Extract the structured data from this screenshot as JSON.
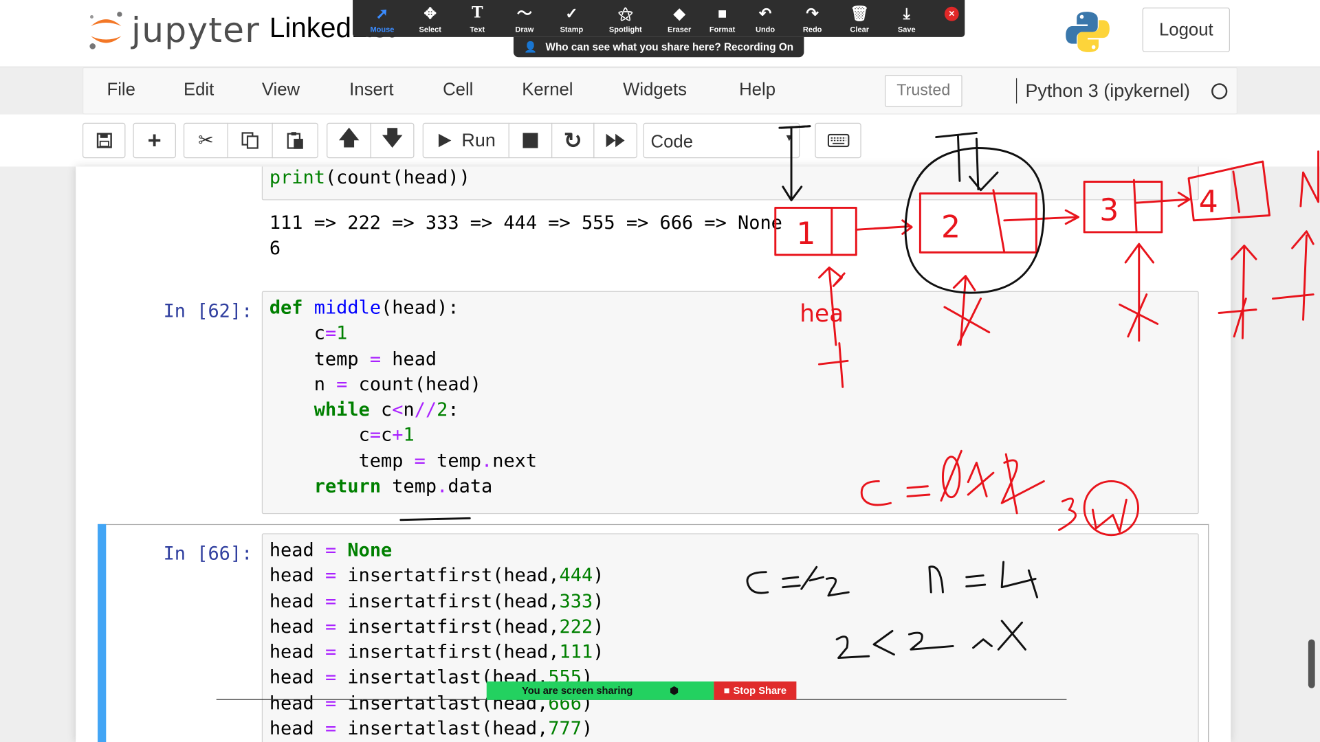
{
  "header": {
    "logo_text": "jupyter",
    "notebook_title": "LinkedList",
    "logout_label": "Logout"
  },
  "menubar": {
    "items": [
      "File",
      "Edit",
      "View",
      "Insert",
      "Cell",
      "Kernel",
      "Widgets",
      "Help"
    ],
    "trusted_label": "Trusted",
    "kernel_label": "Python 3 (ipykernel)"
  },
  "toolbar": {
    "run_label": "Run",
    "cell_type": "Code",
    "icons": [
      "save-icon",
      "plus-icon",
      "scissors-icon",
      "copy-icon",
      "paste-icon",
      "arrow-up-icon",
      "arrow-down-icon",
      "play-icon",
      "stop-icon",
      "restart-icon",
      "fast-forward-icon",
      "keyboard-icon"
    ]
  },
  "zoom_annotation_toolbar": {
    "items": [
      "Mouse",
      "Select",
      "Text",
      "Draw",
      "Stamp",
      "Spotlight",
      "Eraser",
      "Format",
      "Undo",
      "Redo",
      "Clear",
      "Save"
    ],
    "recording_notice": "Who can see what you share here? Recording On"
  },
  "screen_share_bar": {
    "status": "You are screen sharing",
    "stop_label": "Stop Share"
  },
  "cells": {
    "cell1_code_tail": "print(count(head))",
    "cell1_output_line1": "111 => 222 => 333 => 444 => 555 => 666 => None",
    "cell1_output_line2": "6",
    "cell2_prompt": "In [62]:",
    "cell3_prompt": "In [66]:"
  },
  "annotations": {
    "node_labels": [
      "1",
      "2",
      "3",
      "4"
    ],
    "head_label": "hea",
    "note_c": "c = 1 2",
    "note_n": "n = 4",
    "note_cond": "2 < 2"
  }
}
